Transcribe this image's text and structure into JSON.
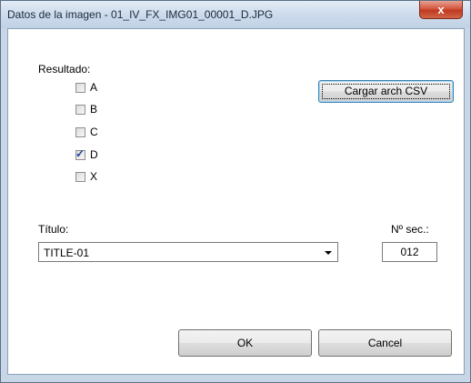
{
  "window": {
    "title": "Datos de la imagen - 01_IV_FX_IMG01_00001_D.JPG",
    "close_glyph": "x"
  },
  "resultado": {
    "label": "Resultado:",
    "options": [
      {
        "label": "A",
        "checked": false
      },
      {
        "label": "B",
        "checked": false
      },
      {
        "label": "C",
        "checked": false
      },
      {
        "label": "D",
        "checked": true
      },
      {
        "label": "X",
        "checked": false
      }
    ]
  },
  "load_csv_button": {
    "label": "Cargar arch CSV"
  },
  "titulo": {
    "label": "Título:",
    "selected_value": "TITLE-01"
  },
  "seq": {
    "label": "Nº sec.:",
    "value": "012"
  },
  "buttons": {
    "ok_label": "OK",
    "cancel_label": "Cancel"
  },
  "colors": {
    "close_button": "#c0391f",
    "check_mark": "#1e3e9a"
  }
}
